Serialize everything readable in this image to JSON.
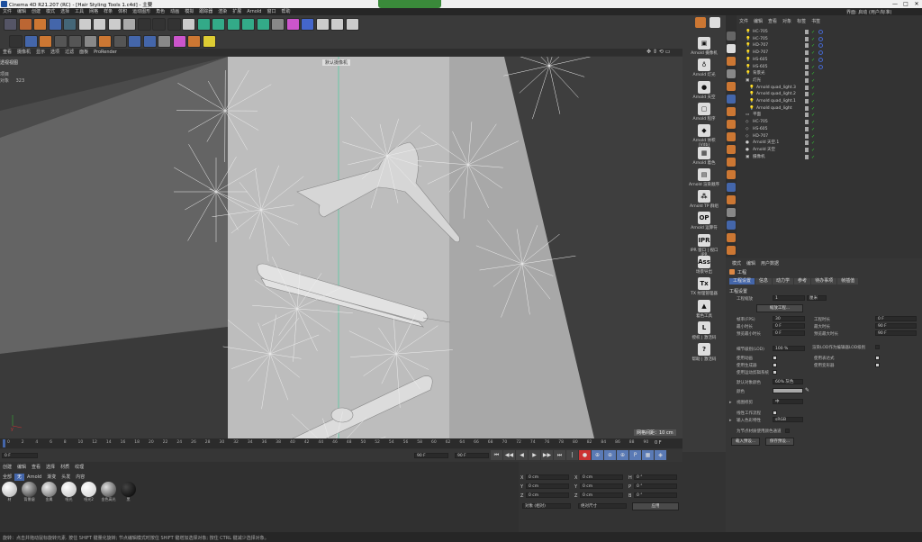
{
  "window": {
    "title": "Cinema 4D R21.207 (RC) - [Hair Styling Tools 1.c4d] - 主要",
    "controls": [
      "—",
      "□",
      "✕"
    ]
  },
  "menu": [
    "文件",
    "编辑",
    "创建",
    "模式",
    "选择",
    "工具",
    "网格",
    "样条",
    "体积",
    "运动图形",
    "角色",
    "动画",
    "模拟",
    "跟踪器",
    "渲染",
    "扩展",
    "Arnold",
    "窗口",
    "帮助"
  ],
  "layout_label": "界面: 启动 (用户/标准)",
  "viewport": {
    "menu": [
      "查看",
      "摄像机",
      "显示",
      "选项",
      "过滤",
      "面板",
      "ProRender"
    ],
    "name": "透视视图",
    "info": [
      {
        "k": "项目",
        "v": ""
      },
      {
        "k": "对象",
        "v": "323"
      }
    ],
    "camera_label": "默认摄像机",
    "grid_label": "网格间距：10 cm"
  },
  "timeline": {
    "ticks": [
      "0",
      "2",
      "4",
      "6",
      "8",
      "10",
      "12",
      "14",
      "16",
      "18",
      "20",
      "22",
      "24",
      "26",
      "28",
      "30",
      "32",
      "34",
      "36",
      "38",
      "40",
      "42",
      "44",
      "46",
      "48",
      "50",
      "52",
      "54",
      "56",
      "58",
      "60",
      "62",
      "64",
      "66",
      "68",
      "70",
      "72",
      "74",
      "76",
      "78",
      "80",
      "82",
      "84",
      "86",
      "88",
      "90"
    ],
    "end_label": "0 F"
  },
  "transport": {
    "start": "0 F",
    "cur": "0 F",
    "end": "90 F",
    "end2": "90 F"
  },
  "material": {
    "menu": [
      "创建",
      "编辑",
      "查看",
      "选择",
      "材质",
      "纹理"
    ],
    "filters": [
      "全部",
      "无",
      "Arnold",
      "渐变",
      "头发",
      "内容"
    ],
    "items": [
      "材",
      "背景烟",
      "金属",
      "哑光",
      "哑光2",
      "金色高光",
      "黑"
    ]
  },
  "coord": {
    "rows": [
      {
        "a": "X",
        "av": "0 cm",
        "b": "X",
        "bv": "0 cm",
        "c": "H",
        "cv": "0 °"
      },
      {
        "a": "Y",
        "av": "0 cm",
        "b": "Y",
        "bv": "0 cm",
        "c": "P",
        "cv": "0 °"
      },
      {
        "a": "Z",
        "av": "0 cm",
        "b": "Z",
        "bv": "0 cm",
        "c": "B",
        "cv": "0 °"
      }
    ],
    "mode1": "对象 (相对)",
    "mode2": "绝对尺寸",
    "apply": "应用"
  },
  "status": "旋转：点击并拖动鼠标旋转元素. 按住 SHIFT 键量化旋转; 节点编辑模式时按住 SHIFT 键增加选择对象; 按住 CTRL 键减少选择对象。",
  "arnold": [
    {
      "ic": "▣",
      "l": "Arnold 摄像机"
    },
    {
      "ic": "♁",
      "l": "Arnold 灯光"
    },
    {
      "ic": "●",
      "l": "Arnold 天空"
    },
    {
      "ic": "▢",
      "l": "Arnold 程序"
    },
    {
      "ic": "◆",
      "l": "Arnold 体积 (Vdb)"
    },
    {
      "ic": "▦",
      "l": "Arnold 着色"
    },
    {
      "ic": "▤",
      "l": "Arnold 渲染顺序"
    },
    {
      "ic": "⁂",
      "l": "Arnold TP 群组"
    },
    {
      "ic": "OP",
      "l": "Arnold 运算符"
    },
    {
      "ic": "IPR",
      "l": "IPR 窗口 | 视口IPR"
    },
    {
      "ic": "Ass",
      "l": "场景导出"
    },
    {
      "ic": "Tx",
      "l": "TX 纹理管理器"
    },
    {
      "ic": "▲",
      "l": "着色工具"
    },
    {
      "ic": "L",
      "l": "授权 | 激活码"
    },
    {
      "ic": "?",
      "l": "帮助 | 激活码"
    }
  ],
  "objmgr": {
    "menu": [
      "文件",
      "编辑",
      "查看",
      "对象",
      "标签",
      "书签"
    ],
    "rows": [
      {
        "n": "HC-705",
        "lv": 0,
        "ic": "💡",
        "tag": true
      },
      {
        "n": "HC-705",
        "lv": 0,
        "ic": "💡",
        "tag": true
      },
      {
        "n": "HD-707",
        "lv": 0,
        "ic": "💡",
        "tag": true
      },
      {
        "n": "HD-707",
        "lv": 0,
        "ic": "💡",
        "tag": true
      },
      {
        "n": "HS-605",
        "lv": 0,
        "ic": "💡",
        "tag": true
      },
      {
        "n": "HS-605",
        "lv": 0,
        "ic": "💡",
        "tag": true
      },
      {
        "n": "背景光",
        "lv": 0,
        "ic": "💡",
        "tag": false
      },
      {
        "n": "灯光",
        "lv": 0,
        "ic": "▣",
        "tag": false
      },
      {
        "n": "Arnold quad_light.3",
        "lv": 1,
        "ic": "💡",
        "tag": false
      },
      {
        "n": "Arnold quad_light.2",
        "lv": 1,
        "ic": "💡",
        "tag": false
      },
      {
        "n": "Arnold quad_light.1",
        "lv": 1,
        "ic": "💡",
        "tag": false
      },
      {
        "n": "Arnold quad_light",
        "lv": 1,
        "ic": "💡",
        "tag": false
      },
      {
        "n": "平面",
        "lv": 0,
        "ic": "▭",
        "tag": false
      },
      {
        "n": "HC-705",
        "lv": 0,
        "ic": "◇",
        "tag": false
      },
      {
        "n": "HS-605",
        "lv": 0,
        "ic": "◇",
        "tag": false
      },
      {
        "n": "HD-707",
        "lv": 0,
        "ic": "◇",
        "tag": false
      },
      {
        "n": "Arnold 天空.1",
        "lv": 0,
        "ic": "●",
        "tag": false
      },
      {
        "n": "Arnold 天空",
        "lv": 0,
        "ic": "●",
        "tag": false
      },
      {
        "n": "摄像机",
        "lv": 0,
        "ic": "▣",
        "tag": false
      }
    ]
  },
  "attr": {
    "menu": [
      "模式",
      "编辑",
      "用户数据"
    ],
    "title": "工程",
    "tabs": [
      "工程设置",
      "信息",
      "动力学",
      "参考",
      "待办事项",
      "帧插值"
    ],
    "section": "工程设置",
    "scale_label": "工程缩放",
    "scale_val": "1",
    "scale_unit": "厘米",
    "scale_btn": "缩放工程...",
    "left": [
      {
        "k": "帧率(FPS)",
        "v": "30"
      },
      {
        "k": "最小时长",
        "v": "0 F"
      },
      {
        "k": "预览最小时长",
        "v": "0 F"
      },
      {
        "k": "细节级别(LOD)",
        "v": "100 %"
      }
    ],
    "right": [
      {
        "k": "工程时长",
        "v": "0 F"
      },
      {
        "k": "最大时长",
        "v": "90 F"
      },
      {
        "k": "预览最大时长",
        "v": "90 F"
      }
    ],
    "lod_render": "渲染LOD作为编辑器LOD级别",
    "checks_l": [
      "使用动画",
      "使用生成器",
      "使用运动剪辑系统"
    ],
    "checks_r": [
      "使用表达式",
      "使用变形器"
    ],
    "color_label": "默认对象颜色",
    "color_val": "60% 灰色",
    "color2": "颜色",
    "view_clip": "视图修剪",
    "view_clip_val": "中",
    "linear": "线性工作流程",
    "input_color": "输入色彩特性",
    "input_val": "sRGB",
    "node_mat": "为节点材质使用颜色通道",
    "load_btn": "载入预设...",
    "save_btn": "保存预设..."
  }
}
